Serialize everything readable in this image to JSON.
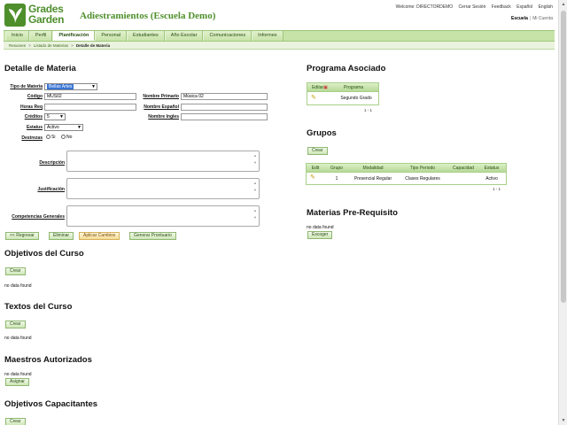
{
  "header": {
    "logo_line1": "Grades",
    "logo_line2": "Garden",
    "app_title": "Adiestramientos (Escuela Demo)",
    "top_links": [
      "Welcome: DIRECTORDEMO",
      "Cerrar Sesión",
      "Feedback",
      "Español",
      "English"
    ],
    "school_link": "Escuela",
    "separator": "|",
    "account_link": "Mi Cuenta"
  },
  "nav": {
    "tabs": [
      "Inicio",
      "Perfil",
      "Planificación",
      "Personal",
      "Estudiantes",
      "Año Escolar",
      "Comunicaciones",
      "Informes"
    ],
    "active": "Planificación"
  },
  "breadcrumb": {
    "items": [
      "Resumen",
      "Listado de Materias",
      "Detalle de Materia"
    ]
  },
  "detalle": {
    "title": "Detalle de Materia",
    "tipo_label": "Tipo de Materia",
    "tipo_value": "Bellas Artes",
    "codigo_label": "Código",
    "codigo_value": "MUS02",
    "nombre_primario_label": "Nombre Primario",
    "nombre_primario_value": "Música 02",
    "horas_label": "Horas Req",
    "horas_value": "",
    "nombre_espanol_label": "Nombre Español",
    "nombre_espanol_value": "",
    "creditos_label": "Créditos",
    "creditos_value": "5",
    "nombre_ingles_label": "Nombre Ingles",
    "nombre_ingles_value": "",
    "estatus_label": "Estatus",
    "estatus_value": "Activo",
    "destrezas_label": "Destrezas",
    "si_label": "Si",
    "no_label": "No",
    "descripcion_label": "Descripción",
    "justificacion_label": "Justificación",
    "competencias_label": "Competencias Generales",
    "btn_regresar": "<< Regresar",
    "btn_eliminar": "Eliminar",
    "btn_aplicar": "Aplicar Cambios",
    "btn_prontuario": "Generar Prontuario"
  },
  "objetivos": {
    "title": "Objetivos del Curso",
    "btn": "Crear",
    "nodata": "no data found"
  },
  "textos": {
    "title": "Textos del Curso",
    "btn": "Crear",
    "nodata": "no data found"
  },
  "maestros": {
    "title": "Maestros Autorizados",
    "nodata": "no data found",
    "btn": "Asignar"
  },
  "capacitantes": {
    "title": "Objetivos Capacitantes",
    "btn": "Crear"
  },
  "programa": {
    "title": "Programa Asociado",
    "headers": [
      "Editar",
      "Programa"
    ],
    "rows": [
      {
        "programa": "Segundo Grado"
      }
    ],
    "pager": "1 - 1"
  },
  "grupos": {
    "title": "Grupos",
    "btn": "Crear",
    "headers": [
      "Edit",
      "Grupo",
      "Modalidad",
      "Tipo Periodo",
      "Capacidad",
      "Estatus"
    ],
    "rows": [
      {
        "grupo": "1",
        "modalidad": "Presencial Regular",
        "tipo_periodo": "Clases Regulares",
        "capacidad": "",
        "estatus": "Activo"
      }
    ],
    "pager": "1 - 1"
  },
  "prerequisito": {
    "title": "Materias Pre-Requisito",
    "nodata": "no data found",
    "btn": "Escoger"
  },
  "colors": {
    "brand_green": "#4e8f2c",
    "nav_bg": "#c7e3a8",
    "accent_orange": "#f6dc93"
  }
}
